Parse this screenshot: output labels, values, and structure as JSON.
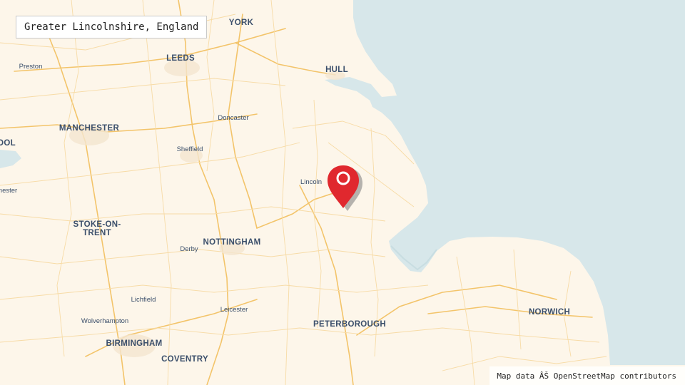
{
  "location_label": "Greater Lincolnshire, England",
  "attribution": "Map data ÂŠ OpenStreetMap contributors",
  "colors": {
    "land": "#fdf6ea",
    "sea": "#d7e7ea",
    "road": "#f7d28a",
    "marker": "#e0282e",
    "label": "#3b4f6b"
  },
  "marker_icon": "map-pin-icon",
  "cities": [
    {
      "id": "york",
      "name": "YORK",
      "size": "big"
    },
    {
      "id": "leeds",
      "name": "LEEDS",
      "size": "big"
    },
    {
      "id": "preston",
      "name": "Preston",
      "size": "small"
    },
    {
      "id": "hull",
      "name": "HULL",
      "size": "big"
    },
    {
      "id": "doncaster",
      "name": "Doncaster",
      "size": "small"
    },
    {
      "id": "manchester",
      "name": "MANCHESTER",
      "size": "big"
    },
    {
      "id": "liverpool",
      "name": "OOL",
      "size": "big"
    },
    {
      "id": "sheffield",
      "name": "Sheffield",
      "size": "small"
    },
    {
      "id": "lincoln",
      "name": "Lincoln",
      "size": "small"
    },
    {
      "id": "chester",
      "name": "nester",
      "size": "small"
    },
    {
      "id": "stoke",
      "name": "STOKE-ON-",
      "size": "big"
    },
    {
      "id": "stoke2",
      "name": "TRENT",
      "size": "big"
    },
    {
      "id": "nottingham",
      "name": "NOTTINGHAM",
      "size": "big"
    },
    {
      "id": "derby",
      "name": "Derby",
      "size": "small"
    },
    {
      "id": "lichfield",
      "name": "Lichfield",
      "size": "small"
    },
    {
      "id": "leicester",
      "name": "Leicester",
      "size": "small"
    },
    {
      "id": "norwich",
      "name": "NORWICH",
      "size": "big"
    },
    {
      "id": "wolverhampton",
      "name": "Wolverhampton",
      "size": "small"
    },
    {
      "id": "peterborough",
      "name": "PETERBOROUGH",
      "size": "big"
    },
    {
      "id": "birmingham",
      "name": "BIRMINGHAM",
      "size": "big"
    },
    {
      "id": "coventry",
      "name": "COVENTRY",
      "size": "big"
    }
  ]
}
